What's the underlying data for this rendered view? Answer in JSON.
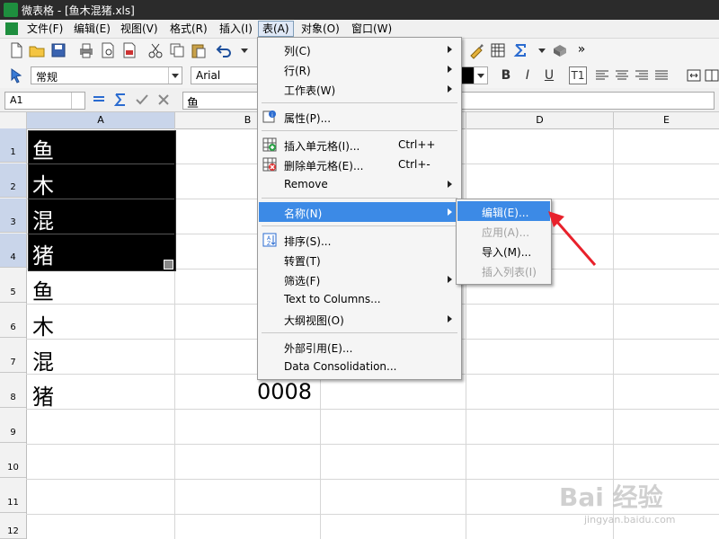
{
  "window": {
    "title": "微表格 - [鱼木混猪.xls]"
  },
  "menubar": {
    "items": [
      "文件(F)",
      "编辑(E)",
      "视图(V)",
      "格式(R)",
      "插入(I)",
      "表(A)",
      "对象(O)",
      "窗口(W)"
    ],
    "open_item": "表(A)"
  },
  "toolbar": {
    "style_combo": "常规",
    "font_combo": "Arial",
    "more_glyph": "»"
  },
  "format_toolbar": {
    "bold": "B",
    "italic": "I",
    "underline": "U",
    "t1": "T1"
  },
  "formula_bar": {
    "cell_ref": "A1",
    "content": "鱼"
  },
  "grid": {
    "columns": [
      "A",
      "B",
      "C",
      "D",
      "E"
    ],
    "selected_column": "A",
    "rows": [
      "1",
      "2",
      "3",
      "4",
      "5",
      "6",
      "7",
      "8",
      "9",
      "10",
      "11",
      "12"
    ],
    "selected_rows": [
      "1",
      "2",
      "3",
      "4"
    ],
    "cells_a": [
      "鱼",
      "木",
      "混",
      "猪",
      "鱼",
      "木",
      "混",
      "猪"
    ],
    "cell_b8": "0008"
  },
  "table_menu": {
    "items": [
      {
        "label": "列(C)",
        "submenu": true,
        "icon": ""
      },
      {
        "label": "行(R)",
        "submenu": true,
        "icon": ""
      },
      {
        "label": "工作表(W)",
        "submenu": true,
        "icon": ""
      },
      {
        "label": "属性(P)...",
        "icon": "properties-icon"
      },
      {
        "label": "插入单元格(I)...",
        "shortcut": "Ctrl++",
        "icon": "insert-cells-icon"
      },
      {
        "label": "删除单元格(E)...",
        "shortcut": "Ctrl+-",
        "icon": "delete-cells-icon"
      },
      {
        "label": "Remove",
        "submenu": true,
        "icon": ""
      },
      {
        "label": "名称(N)",
        "submenu": true,
        "highlighted": true,
        "icon": ""
      },
      {
        "label": "排序(S)...",
        "icon": "sort-icon"
      },
      {
        "label": "转置(T)",
        "icon": ""
      },
      {
        "label": "筛选(F)",
        "submenu": true,
        "icon": ""
      },
      {
        "label": "Text to Columns...",
        "icon": ""
      },
      {
        "label": "大纲视图(O)",
        "submenu": true,
        "icon": ""
      },
      {
        "label": "外部引用(E)...",
        "icon": ""
      },
      {
        "label": "Data Consolidation...",
        "icon": ""
      }
    ]
  },
  "name_submenu": {
    "items": [
      {
        "label": "编辑(E)...",
        "highlighted": true,
        "disabled": false
      },
      {
        "label": "应用(A)...",
        "disabled": true
      },
      {
        "label": "导入(M)...",
        "disabled": false
      },
      {
        "label": "插入列表(I)",
        "disabled": true
      }
    ]
  },
  "watermark": {
    "brand": "Bai 经验",
    "url": "jingyan.baidu.com"
  },
  "colors": {
    "highlight": "#3c8ae6",
    "selection_fill": "#000000",
    "arrow": "#e8212b",
    "title_bar": "#2b2b2b"
  }
}
